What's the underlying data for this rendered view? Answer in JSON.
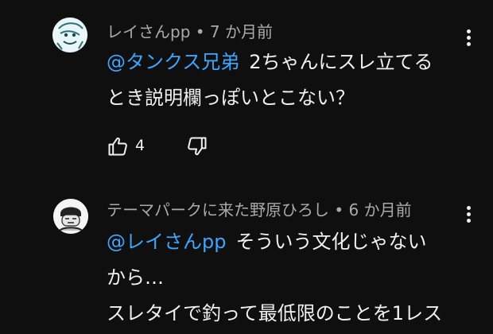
{
  "comments": [
    {
      "author": "レイさんpp",
      "separator": "•",
      "time": "7 か月前",
      "mention": "@タンクス兄弟",
      "lines": [
        "2ちゃんにスレ立てる",
        "とき説明欄っぽいとこない？"
      ],
      "likes": "4",
      "avatar_icon": "user-avatar-sketch",
      "menu_icon": "more-vert-icon"
    },
    {
      "author": "テーマパークに来た野原ひろし",
      "separator": "•",
      "time": "6 か月前",
      "mention": "@レイさんpp",
      "lines": [
        "そういう文化じゃない",
        "から…",
        "スレタイで釣って最低限のことを1レス"
      ],
      "avatar_icon": "user-avatar-manga",
      "menu_icon": "more-vert-icon"
    }
  ],
  "icons": {
    "like": "thumb-up-icon",
    "dislike": "thumb-down-icon"
  },
  "colors": {
    "background": "#0f0f0f",
    "text": "#f1f1f1",
    "meta": "#aaaaaa",
    "mention": "#3ea6ff"
  }
}
